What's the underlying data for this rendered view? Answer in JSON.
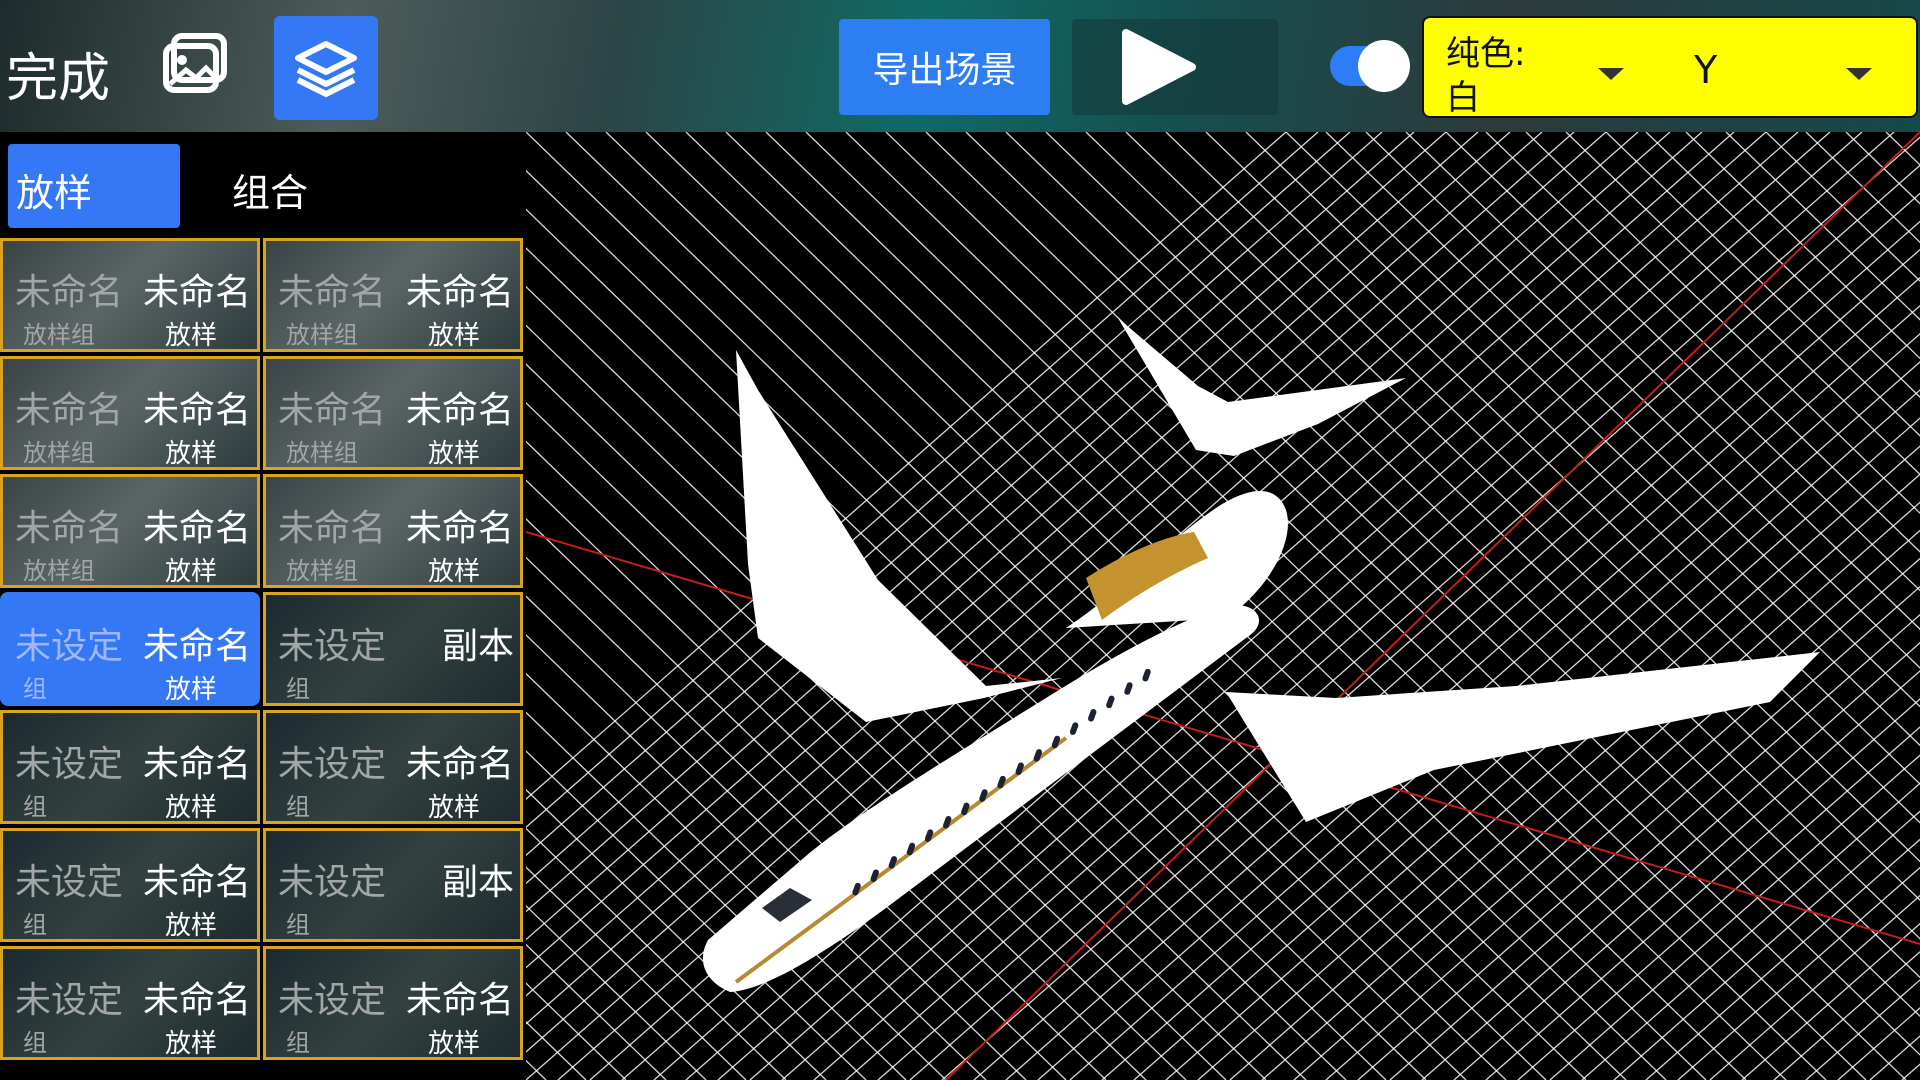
{
  "toolbar": {
    "done_label": "完成",
    "gallery_icon": "image-gallery-icon",
    "layers_icon": "layers-icon",
    "export_label": "导出场景",
    "play_icon": "play-icon",
    "toggle_on": true,
    "fill_label": "纯色:",
    "fill_value": "白",
    "axis_value": "Y",
    "accent_color": "#3478f6",
    "highlight_color": "#ffff00"
  },
  "tabs": [
    {
      "label": "放样",
      "active": true
    },
    {
      "label": "组合",
      "active": false
    }
  ],
  "grid": [
    [
      {
        "l1": "未命名",
        "l2": "放样组",
        "r1": "未命名",
        "r2": "放样"
      },
      {
        "l1": "未命名",
        "l2": "放样组",
        "r1": "未命名",
        "r2": "放样"
      }
    ],
    [
      {
        "l1": "未命名",
        "l2": "放样组",
        "r1": "未命名",
        "r2": "放样"
      },
      {
        "l1": "未命名",
        "l2": "放样组",
        "r1": "未命名",
        "r2": "放样"
      }
    ],
    [
      {
        "l1": "未命名",
        "l2": "放样组",
        "r1": "未命名",
        "r2": "放样"
      },
      {
        "l1": "未命名",
        "l2": "放样组",
        "r1": "未命名",
        "r2": "放样"
      }
    ],
    [
      {
        "l1": "未设定",
        "l2": "组",
        "r1": "未命名",
        "r2": "放样",
        "selected": true
      },
      {
        "l1": "未设定",
        "l2": "组",
        "r1": "副本",
        "r2": ""
      }
    ],
    [
      {
        "l1": "未设定",
        "l2": "组",
        "r1": "未命名",
        "r2": "放样"
      },
      {
        "l1": "未设定",
        "l2": "组",
        "r1": "未命名",
        "r2": "放样"
      }
    ],
    [
      {
        "l1": "未设定",
        "l2": "组",
        "r1": "未命名",
        "r2": "放样"
      },
      {
        "l1": "未设定",
        "l2": "组",
        "r1": "副本",
        "r2": ""
      }
    ],
    [
      {
        "l1": "未设定",
        "l2": "组",
        "r1": "未命名",
        "r2": "放样"
      },
      {
        "l1": "未设定",
        "l2": "组",
        "r1": "未命名",
        "r2": "放样"
      }
    ]
  ],
  "viewport": {
    "model_icon": "airplane-model",
    "grid_color": "#ffffff",
    "axis_color": "#d02020"
  }
}
